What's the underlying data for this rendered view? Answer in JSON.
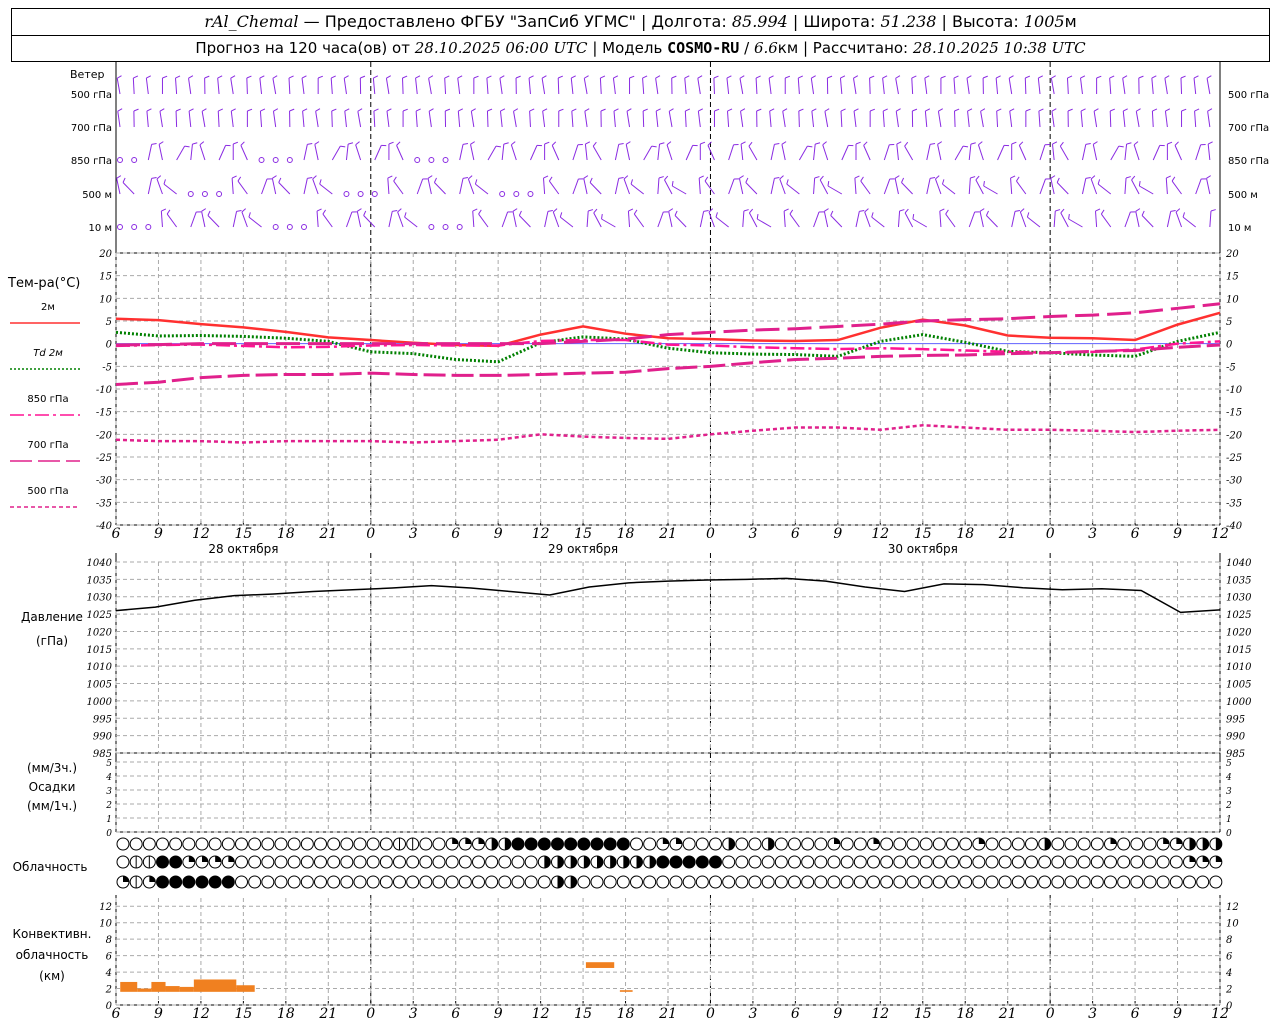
{
  "header": {
    "station": "rAl_Chemal",
    "provider": "Предоставлено ФГБУ \"ЗапСиб УГМС\"",
    "lon_label": "Долгота:",
    "lon": "85.994",
    "lat_label": "Широта:",
    "lat": "51.238",
    "alt_label": "Высота:",
    "alt": "1005",
    "alt_unit": "м",
    "forecast_label": "Прогноз на 120 часа(ов) от",
    "start": "28.10.2025 06:00 UTC",
    "model_label": "Модель",
    "model": "COSMO-RU",
    "resolution": "6.6",
    "res_unit": "км",
    "calc_label": "Рассчитано:",
    "calc_time": "28.10.2025 10:38 UTC"
  },
  "axis": {
    "time_ticks": [
      "6",
      "9",
      "12",
      "15",
      "18",
      "21",
      "0",
      "3",
      "6",
      "9",
      "12",
      "15",
      "18",
      "21",
      "0",
      "3",
      "6",
      "9",
      "12",
      "15",
      "18",
      "21",
      "0",
      "3",
      "6",
      "9",
      "12"
    ],
    "dates": [
      "28 октября",
      "29 октября",
      "30 октября"
    ]
  },
  "wind_panel": {
    "title": "Ветер",
    "levels": [
      "500 гПа",
      "700 гПа",
      "850 гПа",
      "500 м",
      "10 м"
    ],
    "color": "#8a2be2"
  },
  "chart_data": [
    {
      "type": "line",
      "panel": "temperature",
      "ylabel": "Тем-ра(°C)",
      "ylim": [
        -40,
        20
      ],
      "yticks": [
        20,
        15,
        10,
        5,
        0,
        -5,
        -10,
        -15,
        -20,
        -25,
        -30,
        -35,
        -40
      ],
      "x_hours": [
        0,
        3,
        6,
        9,
        12,
        15,
        18,
        21,
        24,
        27,
        30,
        33,
        36,
        39,
        42,
        45,
        48,
        51,
        54,
        57,
        60,
        63,
        66,
        69,
        72,
        75,
        78
      ],
      "series": [
        {
          "name": "2м",
          "color": "#ff3030",
          "style": "solid",
          "values": [
            5.5,
            5.2,
            4.3,
            3.6,
            2.6,
            1.4,
            0.8,
            0.2,
            -0.3,
            -0.5,
            2.0,
            3.8,
            2.2,
            1.2,
            1.0,
            0.7,
            0.6,
            0.8,
            3.5,
            5.3,
            4.0,
            1.8,
            1.3,
            1.2,
            0.8,
            4.2,
            6.8
          ]
        },
        {
          "name": "Td 2м",
          "color": "#008000",
          "style": "dotted",
          "values": [
            2.5,
            1.7,
            1.8,
            1.6,
            1.2,
            0.5,
            -1.8,
            -2.2,
            -3.5,
            -4.0,
            0.2,
            1.5,
            1.0,
            -1.0,
            -2.0,
            -2.3,
            -2.4,
            -2.8,
            0.5,
            2.0,
            0.3,
            -1.7,
            -2.0,
            -2.5,
            -2.8,
            0.5,
            2.5
          ]
        },
        {
          "name": "850 гПа",
          "color": "#ff1493",
          "style": "dashdot",
          "values": [
            -0.5,
            -0.3,
            -0.2,
            -0.5,
            -0.8,
            -0.7,
            -0.4,
            -0.3,
            -0.4,
            -0.4,
            0.6,
            0.8,
            0.8,
            -0.2,
            -0.4,
            -0.8,
            -1.0,
            -1.2,
            -1.0,
            -1.2,
            -1.5,
            -1.8,
            -2.0,
            -1.8,
            -1.3,
            0.0,
            0.5
          ]
        },
        {
          "name": "700 гПа",
          "color": "#e0208c",
          "style": "dashdash",
          "values": [
            -9.0,
            -8.5,
            -7.5,
            -7.0,
            -6.8,
            -6.8,
            -6.5,
            -6.8,
            -7.0,
            -7.0,
            -6.8,
            -6.5,
            -6.3,
            -5.5,
            -5.0,
            -4.2,
            -3.5,
            -3.2,
            -2.8,
            -2.6,
            -2.5,
            -2.2,
            -2.0,
            -1.7,
            -1.5,
            -0.8,
            -0.3
          ]
        },
        {
          "name": "500 гПа",
          "color": "#e0208c",
          "style": "dashed",
          "values": [
            -21.2,
            -21.5,
            -21.5,
            -21.8,
            -21.5,
            -21.5,
            -21.5,
            -21.8,
            -21.5,
            -21.2,
            -20.0,
            -20.5,
            -20.8,
            -21.0,
            -20.0,
            -19.2,
            -18.5,
            -18.5,
            -19.0,
            -18.0,
            -18.5,
            -19.0,
            -19.0,
            -19.2,
            -19.5,
            -19.2,
            -19.0
          ]
        },
        {
          "name": "ext_dash",
          "color": "#e0208c",
          "style": "longdash",
          "values": [
            -0.3,
            -0.2,
            0.0,
            0.0,
            0.0,
            0.0,
            0.0,
            0.0,
            0.0,
            0.0,
            0.0,
            0.5,
            1.0,
            2.0,
            2.5,
            3.0,
            3.3,
            3.8,
            4.3,
            5.0,
            5.3,
            5.5,
            6.0,
            6.3,
            6.8,
            7.8,
            8.8
          ]
        }
      ]
    },
    {
      "type": "line",
      "panel": "pressure",
      "ylabel": "Давление",
      "yunit": "(гПа)",
      "ylim": [
        985,
        1040
      ],
      "yticks": [
        1040,
        1035,
        1030,
        1025,
        1020,
        1015,
        1010,
        1005,
        1000,
        995,
        990,
        985
      ],
      "x_hours": [
        0,
        3,
        6,
        9,
        12,
        15,
        18,
        21,
        24,
        27,
        30,
        33,
        36,
        39,
        42,
        45,
        48,
        51,
        54,
        57,
        60,
        63,
        66,
        69,
        72,
        75,
        78
      ],
      "series": [
        {
          "name": "Давление",
          "color": "#000000",
          "values": [
            1026.0,
            1027.0,
            1029.0,
            1030.3,
            1030.8,
            1031.5,
            1032.0,
            1032.5,
            1033.2,
            1032.5,
            1031.5,
            1030.5,
            1032.8,
            1034.0,
            1034.5,
            1034.8,
            1035.0,
            1035.3,
            1034.5,
            1032.8,
            1031.5,
            1033.7,
            1033.5,
            1032.6,
            1032.0,
            1032.3,
            1031.8,
            1025.5,
            1026.2
          ]
        }
      ]
    },
    {
      "type": "bar",
      "panel": "precipitation",
      "ylabel": "Осадки",
      "yunit_top": "(мм/3ч.)",
      "yunit_bottom": "(мм/1ч.)",
      "ylim": [
        0,
        5
      ],
      "yticks": [
        5,
        4,
        3,
        2,
        1,
        0
      ],
      "values": []
    },
    {
      "type": "bar",
      "panel": "convective_cloud",
      "ylabel_lines": [
        "Конвективн.",
        "облачность",
        "(км)"
      ],
      "ylim": [
        0,
        13
      ],
      "yticks": [
        12,
        10,
        8,
        6,
        4,
        2,
        0
      ],
      "color": "#f08020",
      "bars": [
        {
          "x0": 0.3,
          "x1": 1.5,
          "bottom": 1.6,
          "top": 2.8
        },
        {
          "x0": 1.5,
          "x1": 2.5,
          "bottom": 1.6,
          "top": 2.0
        },
        {
          "x0": 2.5,
          "x1": 3.5,
          "bottom": 1.6,
          "top": 2.8
        },
        {
          "x0": 3.5,
          "x1": 4.5,
          "bottom": 1.6,
          "top": 2.3
        },
        {
          "x0": 4.5,
          "x1": 5.5,
          "bottom": 1.6,
          "top": 2.2
        },
        {
          "x0": 5.5,
          "x1": 8.5,
          "bottom": 1.6,
          "top": 3.1
        },
        {
          "x0": 8.5,
          "x1": 9.8,
          "bottom": 1.6,
          "top": 2.4
        },
        {
          "x0": 33.2,
          "x1": 35.2,
          "bottom": 4.5,
          "top": 5.2
        },
        {
          "x0": 35.6,
          "x1": 36.5,
          "bottom": 1.6,
          "top": 1.8
        }
      ]
    }
  ],
  "cloud_panel": {
    "title": "Облачность",
    "rows": [
      "000000000000000000000110022233444444444002200030030000200200000002000030000200022333",
      "011442222000000000000000000000003333333334444400000000000000000000000000000000000222",
      "2124444440000000000000000000000003300000000000000000000000000000000000000000000000000"
    ]
  }
}
